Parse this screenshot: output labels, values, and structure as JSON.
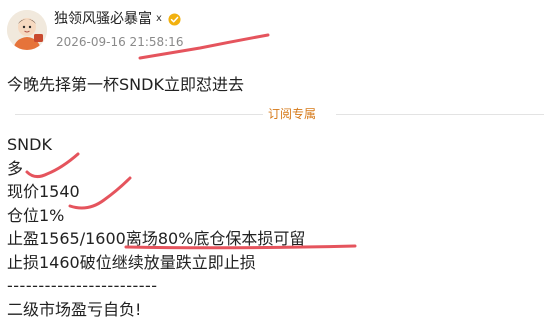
{
  "author": {
    "name": "独领风骚必暴富",
    "badge": "x",
    "verified_icon": "verified-badge-icon",
    "avatar_icon": "cartoon-avatar-icon"
  },
  "post": {
    "timestamp": "2026-09-16 21:58:16",
    "headline": "今晚先择第一杯SNDK立即怼进去",
    "subscriber_label": "订阅专属",
    "body_lines": [
      "SNDK",
      "多",
      "现价1540",
      "仓位1%",
      "止盈1565/1600离场80%底仓保本损可留",
      "止损1460破位继续放量跌立即止损",
      "------------------------",
      "二级市场盈亏自负!"
    ]
  },
  "colors": {
    "annotation_stroke": "#e5545d",
    "subscriber_label": "#d67a1a",
    "timestamp": "#8a8a8a",
    "verified_badge": "#f2b10f"
  }
}
